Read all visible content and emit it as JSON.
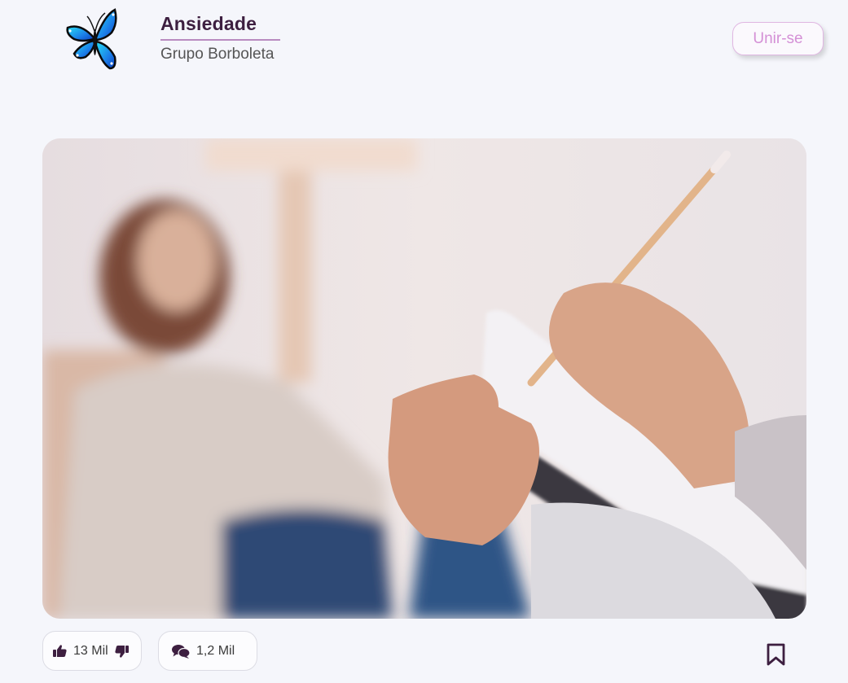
{
  "header": {
    "title": "Ansiedade",
    "subtitle": "Grupo Borboleta",
    "join_label": "Unir-se",
    "logo_icon": "butterfly-icon"
  },
  "post": {
    "image_icon": "therapy-session-photo",
    "likes_label": "13 Mil",
    "comments_label": "1,2 Mil",
    "like_icon": "thumbs-up-icon",
    "dislike_icon": "thumbs-down-icon",
    "comment_icon": "comments-icon",
    "bookmark_icon": "bookmark-icon"
  },
  "colors": {
    "background": "#f5f6fb",
    "title": "#3d1f40",
    "accent": "#d490d6",
    "butterfly": "#1e90ff"
  }
}
